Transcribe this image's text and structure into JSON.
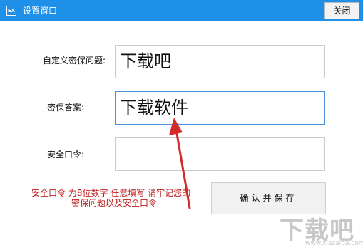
{
  "window": {
    "title": "设置窗口",
    "close_label": "关闭",
    "accent": "#1e90e8"
  },
  "form": {
    "question_label": "自定义密保问题:",
    "question_value": "下载吧",
    "answer_label": "密保答案:",
    "answer_value": "下载软件",
    "password_label": "安全口令:",
    "password_value": ""
  },
  "hint": {
    "line1": "安全口令  为8位数字  任意填写  请牢记您的",
    "line2": "密保问题以及安全口令",
    "color": "#c02020"
  },
  "buttons": {
    "confirm_label": "确认并保存"
  },
  "watermark": {
    "text": "下载吧",
    "url": "www.xiazaiba.com"
  }
}
